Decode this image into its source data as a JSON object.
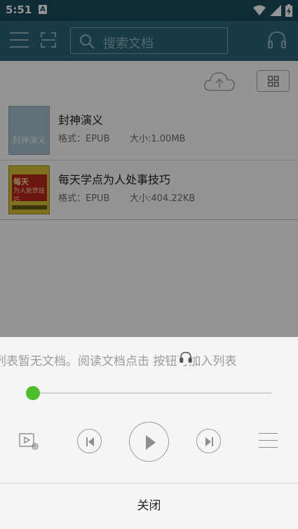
{
  "status": {
    "time": "5:51",
    "notification_badge": "A"
  },
  "toolbar": {
    "search_placeholder": "搜索文档",
    "icons": [
      "menu-icon",
      "scan-icon",
      "search-icon",
      "headphone-icon"
    ]
  },
  "actions": {
    "icons": [
      "cloud-upload-icon",
      "grid-view-icon"
    ]
  },
  "books": [
    {
      "title": "封神演义",
      "format": "格式：EPUB",
      "size": "大小:1.00MB",
      "cover_text": "封神演义"
    },
    {
      "title": "每天学点为人处事技巧",
      "format": "格式：EPUB",
      "size": "大小:404.22KB",
      "cover_text_1": "每天",
      "cover_text_2": "为人处世技巧"
    }
  ],
  "player": {
    "message": "列表暂无文档。阅读文档点击  按钮可加入列表",
    "progress_fraction": 0.0,
    "close_label": "关闭",
    "accent_color": "#4cbd2d",
    "icons": [
      "video-settings-icon",
      "previous-icon",
      "play-icon",
      "next-icon",
      "playlist-icon"
    ]
  }
}
